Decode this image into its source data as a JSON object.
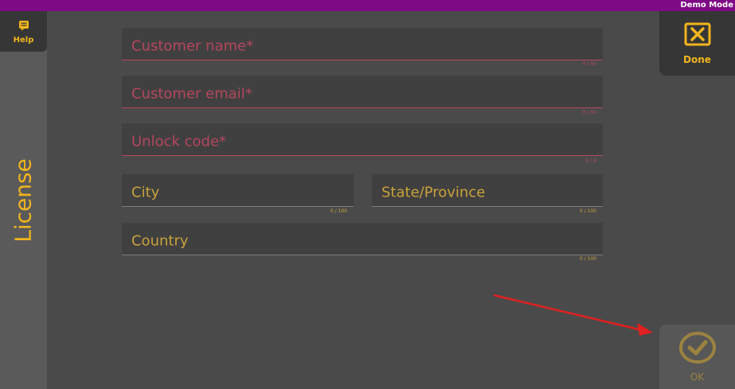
{
  "topbar": {
    "mode_label": "Demo Mode"
  },
  "sidebar": {
    "help_label": "Help",
    "title": "License"
  },
  "form": {
    "customer_name": {
      "placeholder": "Customer name*",
      "value": "",
      "counter": "0 / 60",
      "required": true
    },
    "customer_email": {
      "placeholder": "Customer email*",
      "value": "",
      "counter": "0 / 60",
      "required": true
    },
    "unlock_code": {
      "placeholder": "Unlock code*",
      "value": "",
      "counter": "0 / 9",
      "required": true
    },
    "city": {
      "placeholder": "City",
      "value": "",
      "counter": "0 / 100",
      "required": false
    },
    "state": {
      "placeholder": "State/Province",
      "value": "",
      "counter": "0 / 100",
      "required": false
    },
    "country": {
      "placeholder": "Country",
      "value": "",
      "counter": "0 / 100",
      "required": false
    }
  },
  "actions": {
    "done_label": "Done",
    "ok_label": "OK"
  },
  "colors": {
    "accent": "#f2b51d",
    "required": "#b5475c",
    "topbar": "#7e0a86",
    "annotation_arrow": "#e02020"
  },
  "icons": {
    "help": "help-icon",
    "done": "close-box-icon",
    "ok": "check-circle-icon",
    "annotation": "red-arrow-icon"
  }
}
